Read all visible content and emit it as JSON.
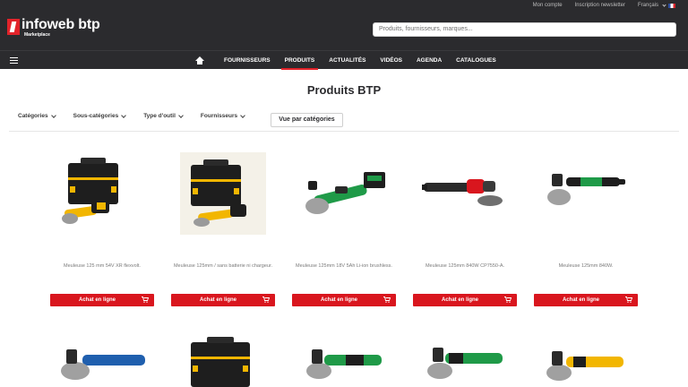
{
  "top_links": {
    "account": "Mon compte",
    "newsletter": "Inscription newsletter",
    "language": "Français"
  },
  "logo": {
    "name": "infoweb btp",
    "sub": "Marketplace"
  },
  "search": {
    "placeholder": "Produits, fournisseurs, marques..."
  },
  "nav": [
    "FOURNISSEURS",
    "PRODUITS",
    "ACTUALITÉS",
    "VIDÉOS",
    "AGENDA",
    "CATALOGUES"
  ],
  "nav_active": "PRODUITS",
  "page_title": "Produits BTP",
  "filters": [
    "Catégories",
    "Sous-catégories",
    "Type d'outil",
    "Fournisseurs"
  ],
  "view_button": "Vue par catégories",
  "products": [
    {
      "name": "Meuleuse 125 mm 54V XR flexvolt.",
      "button": "Achat en ligne"
    },
    {
      "name": "Meuleuse 125mm / sans batterie ni chargeur.",
      "button": "Achat en ligne"
    },
    {
      "name": "Meuleuse 125mm 18V 5Ah Li-ion brushless.",
      "button": "Achat en ligne"
    },
    {
      "name": "Meuleuse 125mm 840W CP7550-A.",
      "button": "Achat en ligne"
    },
    {
      "name": "Meuleuse 125mm 840W.",
      "button": "Achat en ligne"
    }
  ],
  "colors": {
    "header_bg": "#2b2b2e",
    "accent_red": "#d9161e",
    "brand_yellow": "#f2b600",
    "brand_green": "#1f9a48"
  },
  "icons": {
    "home": "home-icon",
    "menu": "hamburger-icon",
    "cart": "cart-icon",
    "dropdown": "chevron-down-icon"
  }
}
